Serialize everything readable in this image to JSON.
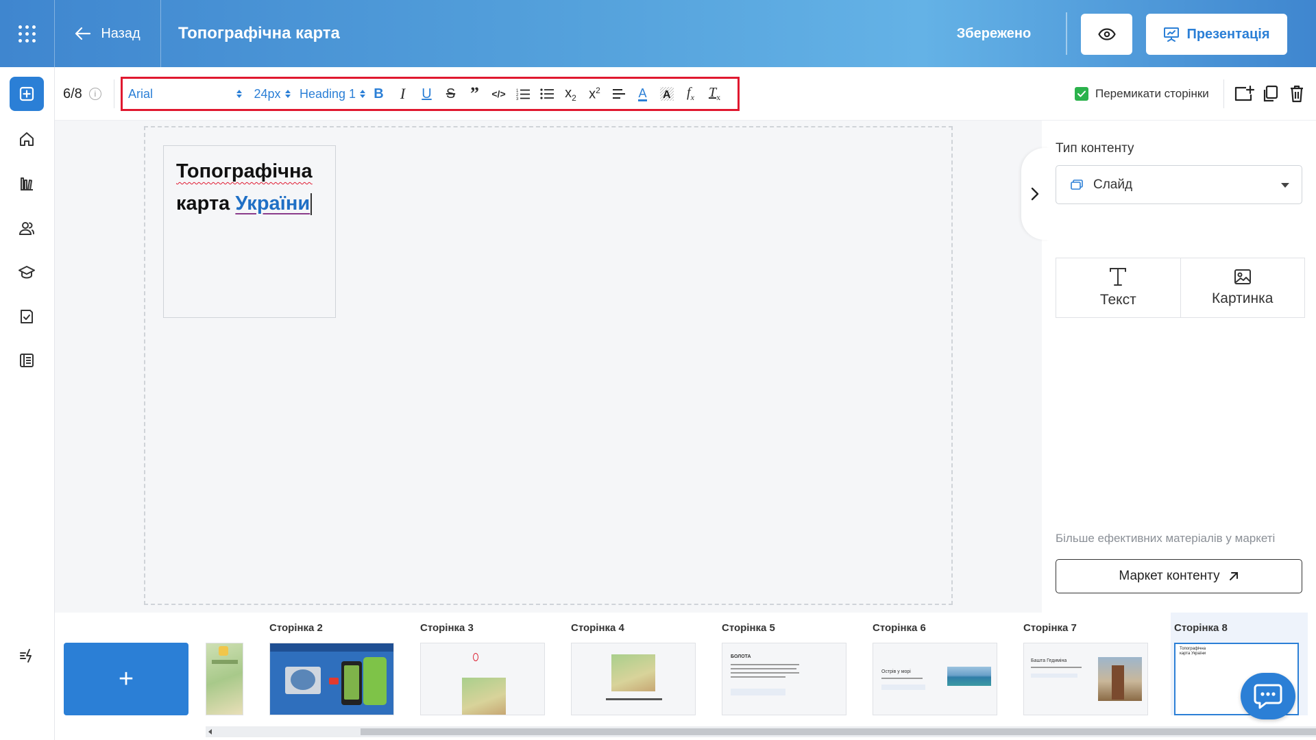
{
  "header": {
    "back_label": "Назад",
    "title": "Топографічна карта",
    "saved_label": "Збережено",
    "present_label": "Презентація"
  },
  "sidebar": {
    "items": [
      "add",
      "home",
      "library",
      "users",
      "courses",
      "tasks",
      "journal",
      "quick-actions"
    ]
  },
  "toolbar": {
    "page_counter": "6/8",
    "font": "Arial",
    "size": "24px",
    "heading": "Heading 1",
    "switch_pages_label": "Перемикати сторінки",
    "switch_pages_checked": true
  },
  "slide": {
    "title_line1": "Топографічна",
    "title_line2_a": "карта",
    "title_line2_b": "України"
  },
  "right_panel": {
    "content_type_label": "Тип контенту",
    "content_type_value": "Слайд",
    "tile_text": "Текст",
    "tile_image": "Картинка",
    "more_label": "Більше ефективних матеріалів у маркеті",
    "market_button": "Маркет контенту"
  },
  "pages": [
    {
      "name": "Сторінка 2"
    },
    {
      "name": "Сторінка 3"
    },
    {
      "name": "Сторінка 4"
    },
    {
      "name": "Сторінка 5",
      "thumb_heading": "БОЛОТА"
    },
    {
      "name": "Сторінка 6",
      "thumb_heading": "Острів у морі"
    },
    {
      "name": "Сторінка 7",
      "thumb_heading": "Башта Гедиміна"
    },
    {
      "name": "Сторінка 8",
      "thumb_text": "Топографічна карта України"
    }
  ],
  "colors": {
    "accent": "#2b7fd6",
    "highlight_border": "#e0182f",
    "check_green": "#2bb24c"
  }
}
